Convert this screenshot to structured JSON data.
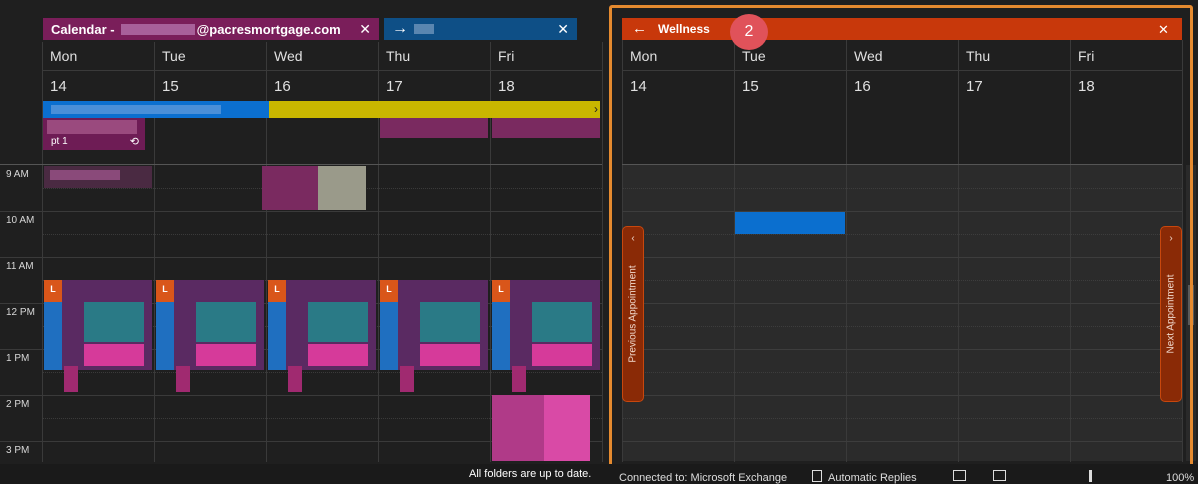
{
  "left_calendar": {
    "tab_title_prefix": "Calendar -",
    "tab_title_email": "@pacresmortgage.com",
    "second_tab_arrow": "→",
    "close_glyph": "✕",
    "days": [
      {
        "name": "Mon",
        "num": "14"
      },
      {
        "name": "Tue",
        "num": "15"
      },
      {
        "name": "Wed",
        "num": "16"
      },
      {
        "name": "Thu",
        "num": "17"
      },
      {
        "name": "Fri",
        "num": "18"
      }
    ],
    "allday_event_text": "pt 1",
    "recurring_glyph": "⟲",
    "times": [
      "9 AM",
      "10 AM",
      "11 AM",
      "12 PM",
      "1 PM",
      "2 PM",
      "3 PM"
    ],
    "lunch_badge": "L"
  },
  "right_calendar": {
    "title": "Wellness",
    "back_glyph": "←",
    "close_glyph": "✕",
    "days": [
      {
        "name": "Mon",
        "num": "14"
      },
      {
        "name": "Tue",
        "num": "15"
      },
      {
        "name": "Wed",
        "num": "16"
      },
      {
        "name": "Thu",
        "num": "17"
      },
      {
        "name": "Fri",
        "num": "18"
      }
    ],
    "prev_label": "Previous Appointment",
    "next_label": "Next Appointment",
    "prev_chevron": "‹",
    "next_chevron": "›"
  },
  "annotation": {
    "badge": "2"
  },
  "status_bar": {
    "sync": "All folders are up to date.",
    "connection": "Connected to: Microsoft Exchange",
    "auto_replies": "Automatic Replies",
    "zoom": "100%"
  },
  "colors": {
    "purple_tab": "#7a1e5a",
    "blue_tab": "#0e4f86",
    "orange_header": "#c8380b",
    "annotation_orange": "#e58a2f",
    "badge_red": "#e0525a",
    "event_blue": "#0b6fcf",
    "event_yellow": "#c9b700"
  }
}
